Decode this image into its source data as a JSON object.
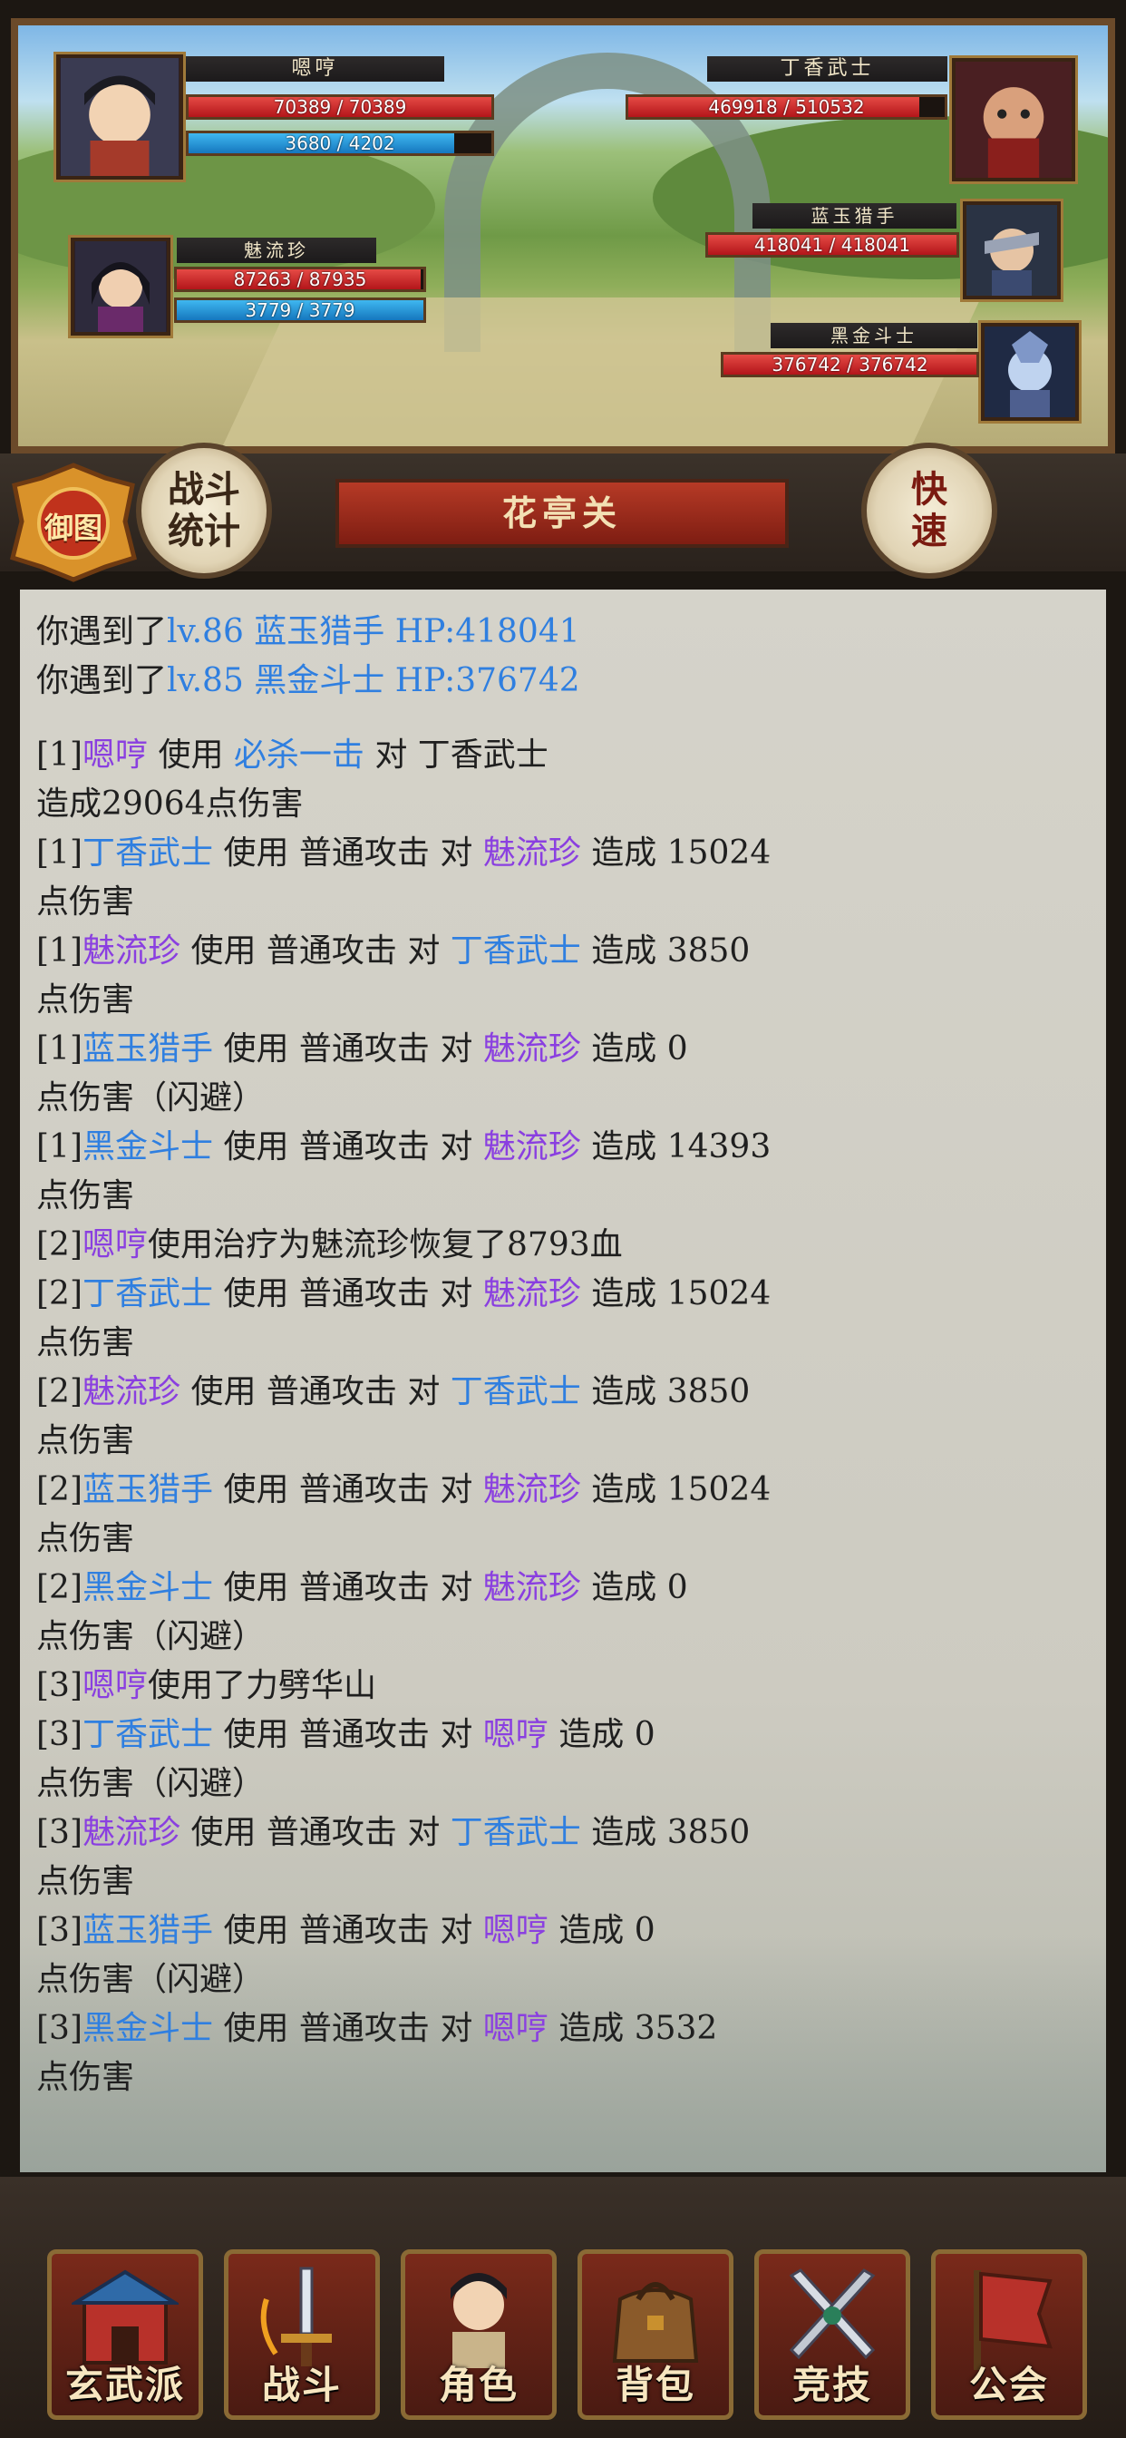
{
  "battle": {
    "players": [
      {
        "name": "嗯哼",
        "hp": "70389 / 70389",
        "hp_frac": 1.0,
        "mp": "3680 / 4202",
        "mp_frac": 0.876
      },
      {
        "name": "魅流珍",
        "hp": "87263 / 87935",
        "hp_frac": 0.99,
        "mp": "3779 / 3779",
        "mp_frac": 1.0
      }
    ],
    "enemies": [
      {
        "name": "丁香武士",
        "hp": "469918 / 510532",
        "hp_frac": 0.92
      },
      {
        "name": "蓝玉猎手",
        "hp": "418041 / 418041",
        "hp_frac": 1.0
      },
      {
        "name": "黑金斗士",
        "hp": "376742 / 376742",
        "hp_frac": 1.0
      }
    ]
  },
  "header": {
    "badge_label": "御图",
    "stats_button": "战斗\n统计",
    "stage_title": "花亭关",
    "speed_button": "快\n速"
  },
  "log": [
    [
      [
        "你遇到了",
        ""
      ],
      [
        "lv.86 蓝玉猎手 HP:418041",
        "b"
      ]
    ],
    [
      [
        "你遇到了",
        ""
      ],
      [
        "lv.85 黑金斗士 HP:376742",
        "b"
      ]
    ],
    "gap",
    [
      [
        "[1]",
        ""
      ],
      [
        "嗯哼",
        "p"
      ],
      [
        " 使用 ",
        ""
      ],
      [
        "必杀一击",
        "b"
      ],
      [
        " 对 丁香武士",
        ""
      ]
    ],
    [
      [
        "造成29064点伤害",
        ""
      ]
    ],
    [
      [
        "[1]",
        ""
      ],
      [
        "丁香武士",
        "b"
      ],
      [
        " 使用 普通攻击 对 ",
        ""
      ],
      [
        "魅流珍",
        "p"
      ],
      [
        " 造成 15024",
        ""
      ]
    ],
    [
      [
        "点伤害",
        ""
      ]
    ],
    [
      [
        "[1]",
        ""
      ],
      [
        "魅流珍",
        "p"
      ],
      [
        " 使用 普通攻击 对 ",
        ""
      ],
      [
        "丁香武士",
        "b"
      ],
      [
        " 造成 3850",
        ""
      ]
    ],
    [
      [
        "点伤害",
        ""
      ]
    ],
    [
      [
        "[1]",
        ""
      ],
      [
        "蓝玉猎手",
        "b"
      ],
      [
        " 使用 普通攻击 对 ",
        ""
      ],
      [
        "魅流珍",
        "p"
      ],
      [
        " 造成 0",
        ""
      ]
    ],
    [
      [
        "点伤害（闪避）",
        ""
      ]
    ],
    [
      [
        "[1]",
        ""
      ],
      [
        "黑金斗士",
        "b"
      ],
      [
        " 使用 普通攻击 对 ",
        ""
      ],
      [
        "魅流珍",
        "p"
      ],
      [
        " 造成 14393",
        ""
      ]
    ],
    [
      [
        "点伤害",
        ""
      ]
    ],
    [
      [
        "[2]",
        ""
      ],
      [
        "嗯哼",
        "p"
      ],
      [
        "使用治疗为魅流珍恢复了8793血",
        ""
      ]
    ],
    [
      [
        "[2]",
        ""
      ],
      [
        "丁香武士",
        "b"
      ],
      [
        " 使用 普通攻击 对 ",
        ""
      ],
      [
        "魅流珍",
        "p"
      ],
      [
        " 造成 15024",
        ""
      ]
    ],
    [
      [
        "点伤害",
        ""
      ]
    ],
    [
      [
        "[2]",
        ""
      ],
      [
        "魅流珍",
        "p"
      ],
      [
        " 使用 普通攻击 对 ",
        ""
      ],
      [
        "丁香武士",
        "b"
      ],
      [
        " 造成 3850",
        ""
      ]
    ],
    [
      [
        "点伤害",
        ""
      ]
    ],
    [
      [
        "[2]",
        ""
      ],
      [
        "蓝玉猎手",
        "b"
      ],
      [
        " 使用 普通攻击 对 ",
        ""
      ],
      [
        "魅流珍",
        "p"
      ],
      [
        " 造成 15024",
        ""
      ]
    ],
    [
      [
        "点伤害",
        ""
      ]
    ],
    [
      [
        "[2]",
        ""
      ],
      [
        "黑金斗士",
        "b"
      ],
      [
        " 使用 普通攻击 对 ",
        ""
      ],
      [
        "魅流珍",
        "p"
      ],
      [
        " 造成 0",
        ""
      ]
    ],
    [
      [
        "点伤害（闪避）",
        ""
      ]
    ],
    [
      [
        "[3]",
        ""
      ],
      [
        "嗯哼",
        "p"
      ],
      [
        "使用了力劈华山",
        ""
      ]
    ],
    [
      [
        "[3]",
        ""
      ],
      [
        "丁香武士",
        "b"
      ],
      [
        " 使用 普通攻击 对 ",
        ""
      ],
      [
        "嗯哼",
        "p"
      ],
      [
        " 造成 0",
        ""
      ]
    ],
    [
      [
        "点伤害（闪避）",
        ""
      ]
    ],
    [
      [
        "[3]",
        ""
      ],
      [
        "魅流珍",
        "p"
      ],
      [
        " 使用 普通攻击 对 ",
        ""
      ],
      [
        "丁香武士",
        "b"
      ],
      [
        " 造成 3850",
        ""
      ]
    ],
    [
      [
        "点伤害",
        ""
      ]
    ],
    [
      [
        "[3]",
        ""
      ],
      [
        "蓝玉猎手",
        "b"
      ],
      [
        " 使用 普通攻击 对 ",
        ""
      ],
      [
        "嗯哼",
        "p"
      ],
      [
        " 造成 0",
        ""
      ]
    ],
    [
      [
        "点伤害（闪避）",
        ""
      ]
    ],
    [
      [
        "[3]",
        ""
      ],
      [
        "黑金斗士",
        "b"
      ],
      [
        " 使用 普通攻击 对 ",
        ""
      ],
      [
        "嗯哼",
        "p"
      ],
      [
        " 造成 3532",
        ""
      ]
    ],
    [
      [
        "点伤害",
        ""
      ]
    ]
  ],
  "nav": [
    {
      "label": "玄武派",
      "icon": "sect-gate-icon"
    },
    {
      "label": "战斗",
      "icon": "sword-icon"
    },
    {
      "label": "角色",
      "icon": "character-icon"
    },
    {
      "label": "背包",
      "icon": "bag-icon"
    },
    {
      "label": "竞技",
      "icon": "crossed-swords-icon"
    },
    {
      "label": "公会",
      "icon": "guild-flag-icon"
    }
  ],
  "colors": {
    "player_name": "#8a3fe0",
    "enemy_name": "#2f7fe0",
    "hp": "#c4201f",
    "mp": "#1e88d0"
  }
}
